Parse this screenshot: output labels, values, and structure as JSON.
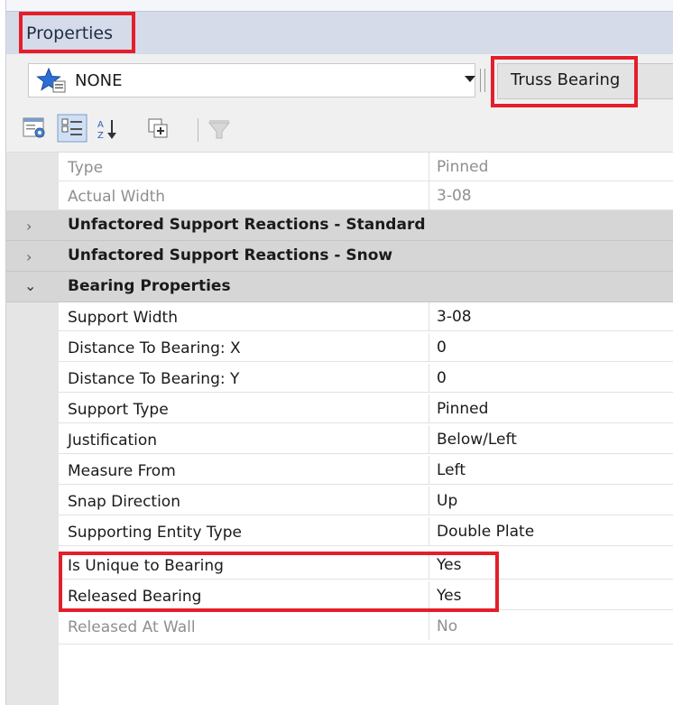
{
  "panel": {
    "title": "Properties"
  },
  "selector": {
    "value": "NONE",
    "type_label": "Truss Bearing"
  },
  "toolbar": {
    "icons": [
      "properties-page-icon",
      "categorized-icon",
      "alphabetical-sort-icon",
      "expand-icon",
      "filter-icon"
    ]
  },
  "top_rows": [
    {
      "label": "Type",
      "value": "Pinned"
    },
    {
      "label": "Actual Width",
      "value": "3-08"
    }
  ],
  "categories": {
    "standard": "Unfactored Support Reactions - Standard",
    "snow": "Unfactored Support Reactions - Snow",
    "bearing": "Bearing Properties"
  },
  "bearing_rows": [
    {
      "label": "Support Width",
      "value": "3-08"
    },
    {
      "label": "Distance To Bearing: X",
      "value": "0"
    },
    {
      "label": "Distance To Bearing: Y",
      "value": "0"
    },
    {
      "label": "Support Type",
      "value": "Pinned"
    },
    {
      "label": "Justification",
      "value": "Below/Left"
    },
    {
      "label": "Measure From",
      "value": "Left"
    },
    {
      "label": "Snap Direction",
      "value": "Up"
    },
    {
      "label": "Supporting Entity Type",
      "value": "Double Plate"
    },
    {
      "label": "Is Unique to Bearing",
      "value": "Yes"
    },
    {
      "label": "Released Bearing",
      "value": "Yes"
    },
    {
      "label": "Released At Wall",
      "value": "No"
    }
  ],
  "colors": {
    "highlight": "#e41e2a",
    "titlebar": "#d6dbe9",
    "category": "#d6d6d6"
  }
}
